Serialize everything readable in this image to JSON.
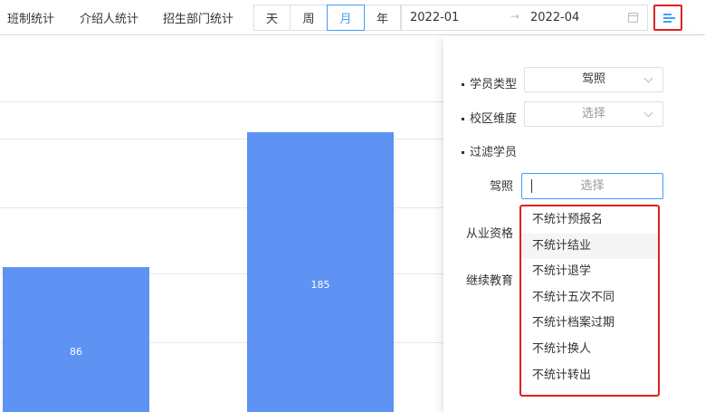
{
  "nav": {
    "tabs": [
      "班制统计",
      "介绍人统计",
      "招生部门统计"
    ]
  },
  "period": {
    "options": [
      "天",
      "周",
      "月",
      "年"
    ],
    "active": "月"
  },
  "date_range": {
    "start": "2022-01",
    "separator": "→",
    "end": "2022-04"
  },
  "chart_data": {
    "type": "bar",
    "categories": [
      "",
      "",
      ""
    ],
    "values": [
      86,
      185,
      null
    ],
    "data_labels": [
      "86",
      "185",
      ""
    ],
    "bar_color": "#5e92f3"
  },
  "filter": {
    "student_type_label": "学员类型",
    "student_type_value": "驾照",
    "campus_label": "校区维度",
    "campus_placeholder": "选择",
    "filter_students_label": "过滤学员",
    "license_label": "驾照",
    "license_placeholder": "选择",
    "qualification_label": "从业资格",
    "continuing_edu_label": "继续教育"
  },
  "dropdown": {
    "items": [
      "不统计预报名",
      "不统计结业",
      "不统计退学",
      "不统计五次不同",
      "不统计档案过期",
      "不统计换人",
      "不统计转出"
    ],
    "hovered_index": 1
  },
  "colors": {
    "accent": "#409eff",
    "highlight_border": "#e02020",
    "bar": "#5e92f3"
  }
}
